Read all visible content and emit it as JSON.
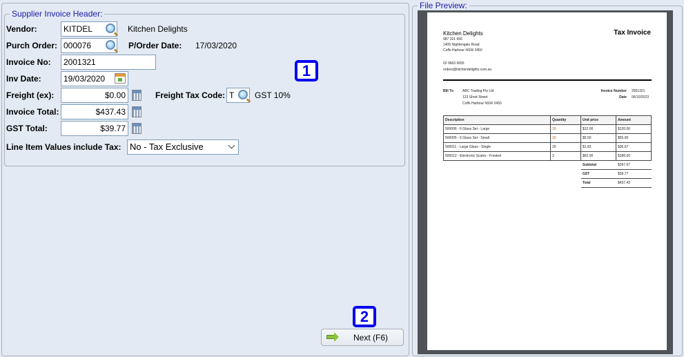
{
  "header_group": {
    "title": "Supplier Invoice Header:",
    "vendor": {
      "label": "Vendor:",
      "value": "KITDEL",
      "name": "Kitchen Delights"
    },
    "purch_order": {
      "label": "Purch Order:",
      "value": "000076",
      "date_label": "P/Order Date:",
      "date": "17/03/2020"
    },
    "invoice_no": {
      "label": "Invoice No:",
      "value": "2001321"
    },
    "inv_date": {
      "label": "Inv Date:",
      "value": "19/03/2020"
    },
    "freight": {
      "label": "Freight (ex):",
      "value": "$0.00",
      "tax_code_label": "Freight Tax Code:",
      "tax_code": "T",
      "tax_desc": "GST 10%"
    },
    "invoice_total": {
      "label": "Invoice Total:",
      "value": "$437.43"
    },
    "gst_total": {
      "label": "GST Total:",
      "value": "$39.77"
    },
    "line_items_tax": {
      "label": "Line Item Values include Tax:",
      "value": "No - Tax Exclusive"
    }
  },
  "badges": [
    "1",
    "2"
  ],
  "next_button": {
    "label": "Next (F6)",
    "icon": "green-arrow-right-icon"
  },
  "preview": {
    "title": "File Preview:",
    "doc": {
      "company": "Kitchen Delights",
      "abn": "987 321 656",
      "addr1": "1405 Nightengale Road",
      "addr2": "Coffs Harbour NSW 2450",
      "phone": "02 9663 0655",
      "email": "orders@kitchendelights.com.au",
      "doc_title": "Tax Invoice",
      "bill_to_label": "Bill To",
      "bill1": "ABC Trading Pty Ltd",
      "bill2": "123 Short Street",
      "bill3": "Coffs Harbour NSW 2450",
      "inv_num_label": "Invoice Number",
      "inv_num": "2001321",
      "date_label": "Date",
      "date": "06/10/2023",
      "columns": [
        "Description",
        "Quantity",
        "Unit price",
        "Amount"
      ],
      "rows": [
        [
          "500006 - 6 Glass Set - Large",
          "10",
          "$12.00",
          "$120.00"
        ],
        [
          "500005 - 6 Glass Set - Small",
          "10",
          "$5.50",
          "$55.00"
        ],
        [
          "500011 - Large Glass - Single",
          "20",
          "$1.83",
          "$36.67"
        ],
        [
          "500012 - Electronic Scales - Frosted",
          "3",
          "$62.00",
          "$186.00"
        ]
      ],
      "totals": [
        [
          "Subtotal",
          "$397.67"
        ],
        [
          "GST",
          "$39.77"
        ],
        [
          "Total",
          "$437.43"
        ]
      ]
    }
  },
  "colors": {
    "background": "#e3eaf4",
    "legend": "#1a1aa8",
    "badge": "#0000ee",
    "preview_bg": "#505358"
  }
}
